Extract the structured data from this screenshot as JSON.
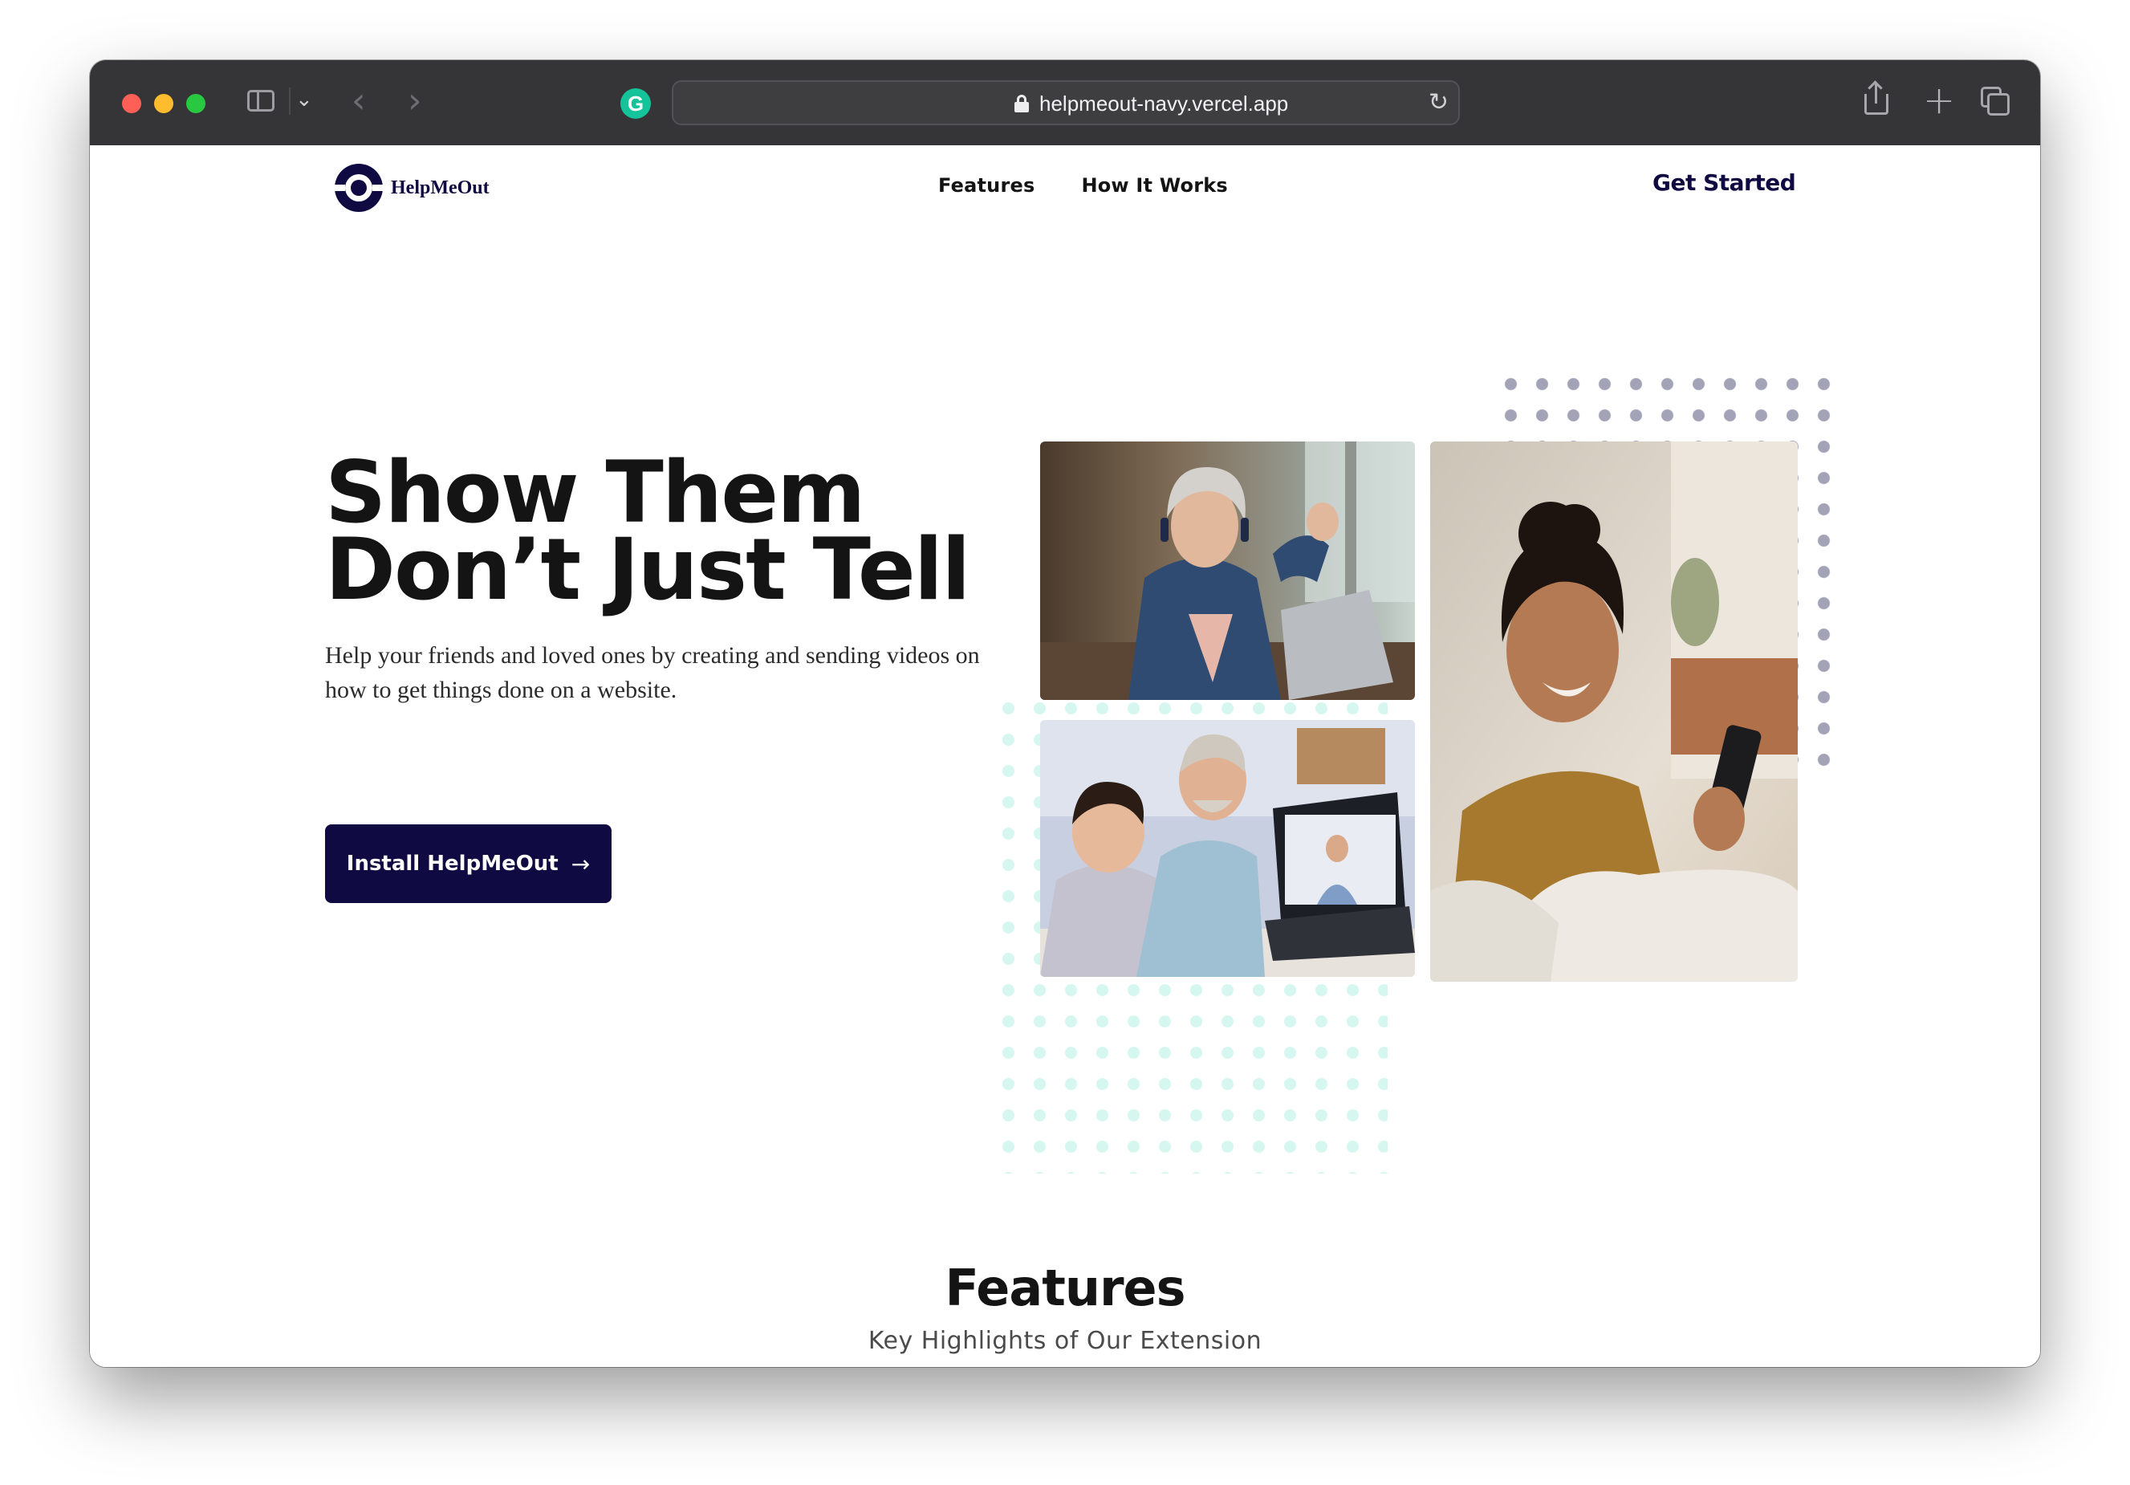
{
  "browser": {
    "url": "helpmeout-navy.vercel.app",
    "icons": {
      "sidebar": "sidebar-toggle-icon",
      "tab_menu": "chevron-down-icon",
      "back": "chevron-left-icon",
      "forward": "chevron-right-icon",
      "extension": "grammarly-icon",
      "lock": "lock-icon",
      "reload": "reload-icon",
      "share": "share-icon",
      "new_tab": "plus-icon",
      "tabs": "tab-overview-icon"
    },
    "extension_glyph": "G"
  },
  "site": {
    "logo_text": "HelpMeOut",
    "nav": {
      "features": "Features",
      "how_it_works": "How It Works",
      "cta": "Get Started"
    },
    "hero": {
      "title_line1": "Show Them",
      "title_line2": "Don’t Just Tell",
      "subtitle": "Help your friends and loved ones by creating and sending videos on how to get things done on a website.",
      "button_label": "Install HelpMeOut",
      "button_icon": "arrow-right-icon"
    },
    "images": [
      "woman-with-headphones-at-laptop-photo",
      "man-and-boy-video-call-photo",
      "smiling-woman-with-phone-photo"
    ],
    "features": {
      "title": "Features",
      "subtitle": "Key Highlights of Our Extension"
    }
  },
  "colors": {
    "brand_navy": "#100a42",
    "text_dark": "#141414",
    "chrome_bg": "#353537",
    "dot_gray": "#a3a3b8",
    "dot_mint": "#d6f6f0"
  }
}
